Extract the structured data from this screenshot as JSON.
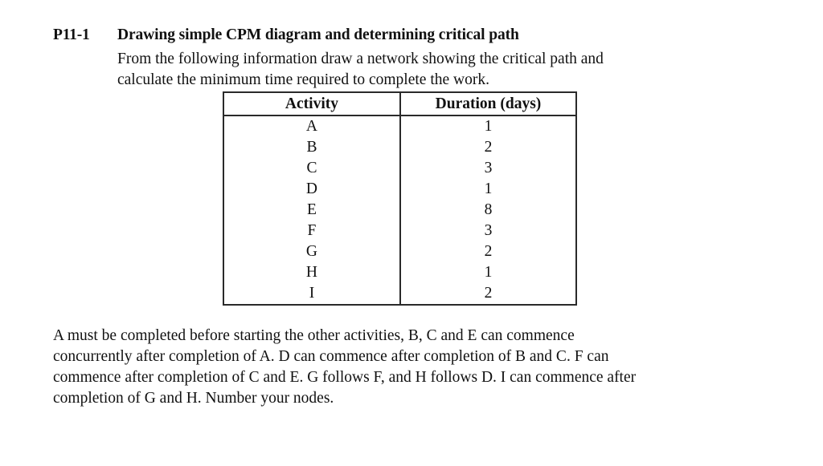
{
  "document": {
    "problem_number": "P11-1",
    "problem_title": "Drawing simple CPM diagram and determining critical path",
    "intro_paragraph": "From the following information draw a network showing the critical path and calculate the minimum time required to complete the work.",
    "intro_lines": [
      "From the following information draw a network showing the critical path and",
      "calculate the minimum time required to complete the work."
    ],
    "conditions_paragraph": "A must be completed before starting the other activities, B, C and E can commence concurrently after completion of A. D can commence after completion of B and C. F can commence after completion of C and E.  G follows F, and H follows D. I can commence after completion of G and H. Number your nodes.",
    "conditions_lines": [
      "A must be completed before starting the other activities, B, C and E can commence",
      "concurrently after completion of A. D can commence after completion of B and C. F can",
      "commence after completion of C and E.  G follows F, and H follows D. I can commence after",
      "completion of G and H. Number your nodes."
    ]
  },
  "table": {
    "headers": [
      "Activity",
      "Duration (days)"
    ],
    "rows": [
      {
        "activity": "A",
        "duration": "1"
      },
      {
        "activity": "B",
        "duration": "2"
      },
      {
        "activity": "C",
        "duration": "3"
      },
      {
        "activity": "D",
        "duration": "1"
      },
      {
        "activity": "E",
        "duration": "8"
      },
      {
        "activity": "F",
        "duration": "3"
      },
      {
        "activity": "G",
        "duration": "2"
      },
      {
        "activity": "H",
        "duration": "1"
      },
      {
        "activity": "I",
        "duration": "2"
      }
    ]
  },
  "style": {
    "page_background": "#ffffff",
    "text_color": "#111111",
    "table_border_color": "#2a2a2a"
  }
}
